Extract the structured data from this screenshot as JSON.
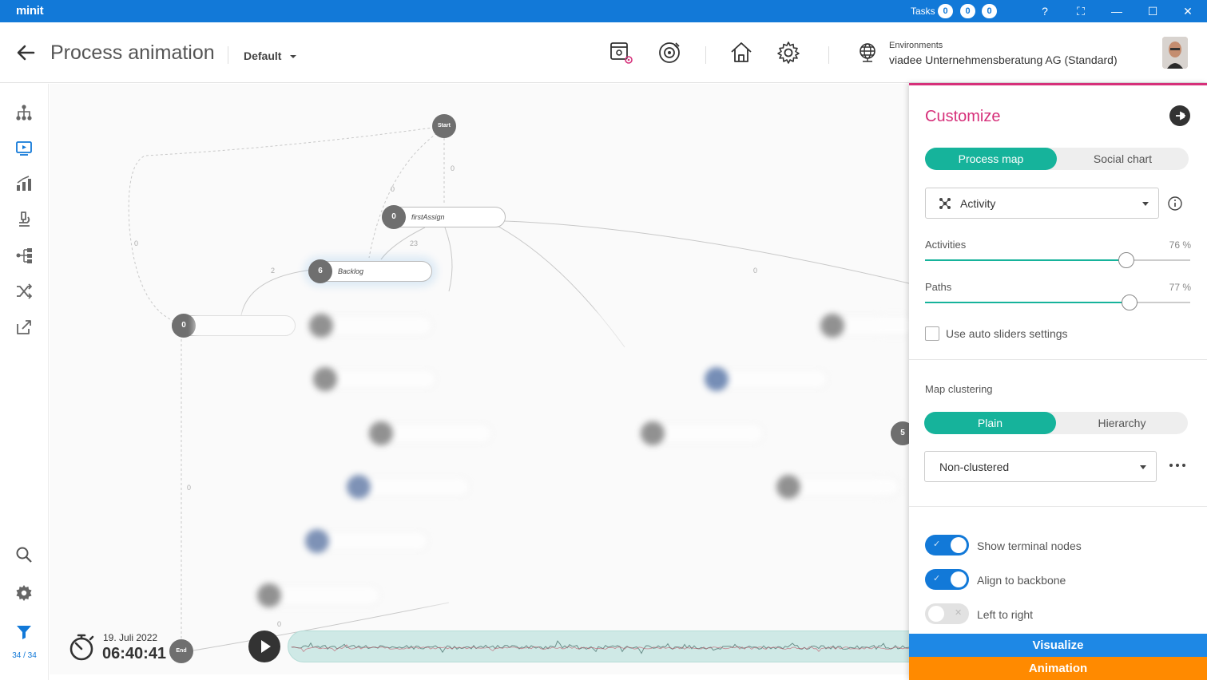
{
  "app": {
    "logo": "minit"
  },
  "titlebar": {
    "tasks_label": "Tasks",
    "task_counts": [
      "0",
      "0",
      "0"
    ],
    "buttons": [
      "?",
      "⛶",
      "—",
      "☐",
      "✕"
    ]
  },
  "header": {
    "title": "Process animation",
    "variant": "Default",
    "env_label": "Environments",
    "env_name": "viadee Unternehmensberatung AG (Standard)"
  },
  "leftnav": {
    "items": [
      "process-map",
      "animation",
      "statistics",
      "analysis",
      "filters",
      "shuffle",
      "export"
    ],
    "filter_count": "34 / 34"
  },
  "map": {
    "start_label": "Start",
    "end_label": "End",
    "nodes": [
      {
        "count": "0",
        "label": "firstAssign"
      },
      {
        "count": "6",
        "label": "Backlog"
      },
      {
        "count": "0",
        "label": ""
      },
      {
        "count": "5",
        "label": ""
      }
    ],
    "edge_labels": [
      "0",
      "0",
      "23",
      "2",
      "0",
      "0",
      "0",
      "0"
    ]
  },
  "playback": {
    "date": "19. Juli 2022",
    "time": "06:40:41",
    "progress": 1.0
  },
  "panel": {
    "title": "Customize",
    "tabs": [
      "Process map",
      "Social chart"
    ],
    "active_tab": 0,
    "dimension": "Activity",
    "activities_label": "Activities",
    "activities_value": "76 %",
    "activities_pct": 76,
    "paths_label": "Paths",
    "paths_value": "77 %",
    "paths_pct": 77,
    "auto_sliders_label": "Use auto sliders settings",
    "auto_sliders_checked": false,
    "clustering_label": "Map clustering",
    "clustering_tabs": [
      "Plain",
      "Hierarchy"
    ],
    "clustering_active": 0,
    "clustering_select": "Non-clustered",
    "toggles": [
      {
        "label": "Show terminal nodes",
        "on": true
      },
      {
        "label": "Align to backbone",
        "on": true
      },
      {
        "label": "Left to right",
        "on": false
      }
    ],
    "visualize_label": "Visualize",
    "animation_label": "Animation"
  },
  "colors": {
    "brand_blue": "#1279d8",
    "accent_pink": "#d6307a",
    "teal": "#16b39b",
    "orange": "#ff8a00"
  }
}
